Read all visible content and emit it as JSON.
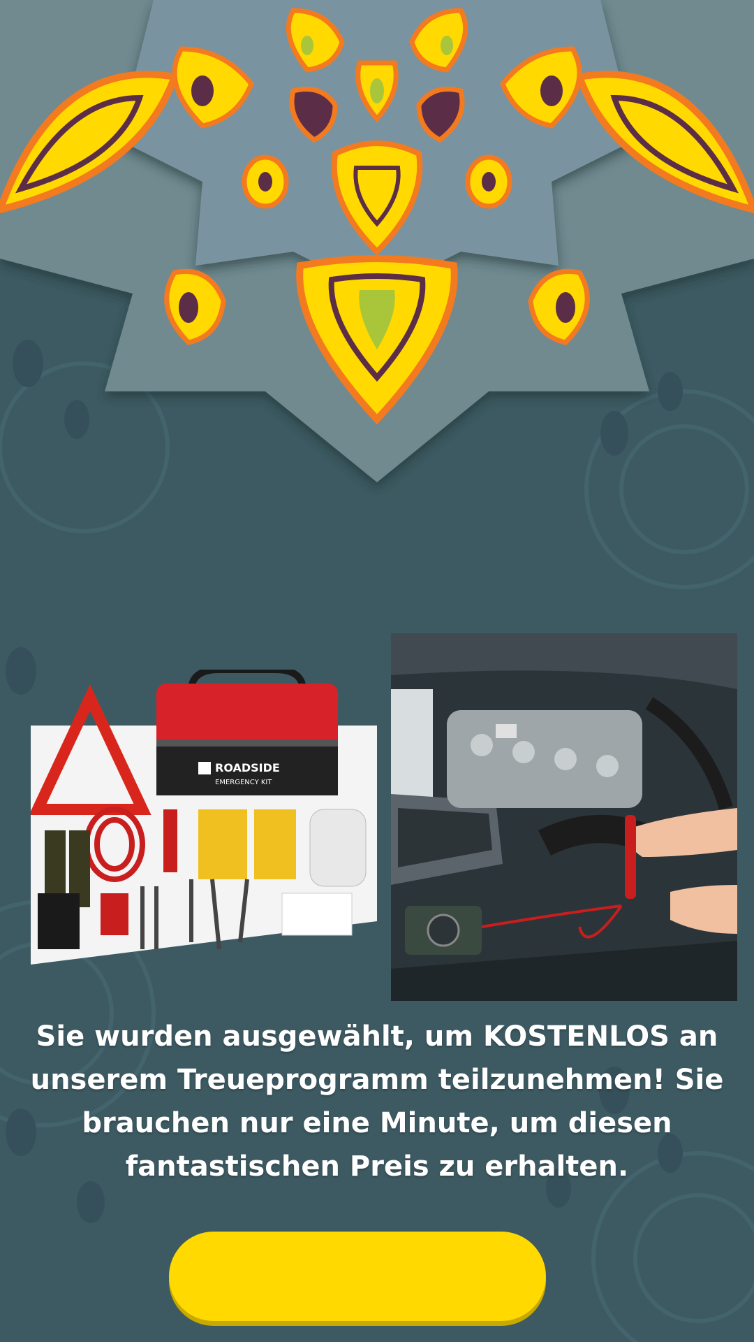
{
  "colors": {
    "background": "#3d5a62",
    "mandala_petal": "#6f8a90",
    "accent_yellow": "#ffd900",
    "accent_orange": "#f47a1f",
    "accent_purple": "#5b2d46",
    "accent_green": "#a9c63a",
    "headline_text": "#ffffff",
    "button": "#ffd900"
  },
  "hero": {
    "decoration": "mandala-flower"
  },
  "products": {
    "left": {
      "icon": "emergency-kit-image",
      "bag_brand": "ROADSIDE",
      "bag_subtitle": "EMERGENCY KIT"
    },
    "right": {
      "icon": "car-engine-diagnostic-image"
    }
  },
  "headline": {
    "text": "Sie wurden ausgewählt, um KOSTENLOS an unserem Treueprogramm teilzunehmen! Sie brauchen nur eine Minute, um diesen fantastischen Preis zu erhalten."
  },
  "cta": {
    "label": ""
  }
}
